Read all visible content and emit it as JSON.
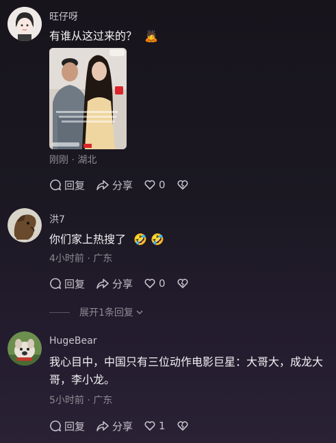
{
  "comments": [
    {
      "username": "旺仔呀",
      "text": "有谁从这过来的？",
      "emoji": "🙇",
      "meta": "刚刚 · 湖北",
      "actions": {
        "reply": "回复",
        "share": "分享",
        "likes": "0"
      }
    },
    {
      "username": "洪7",
      "text": "你们家上热搜了",
      "emoji": "🤣 🤣",
      "meta": "4小时前 · 广东",
      "actions": {
        "reply": "回复",
        "share": "分享",
        "likes": "0"
      },
      "expand": "展开1条回复"
    },
    {
      "username": "HugeBear",
      "text": "我心目中，中国只有三位动作电影巨星：大哥大，成龙大哥，李小龙。",
      "meta": "5小时前 · 广东",
      "actions": {
        "reply": "回复",
        "share": "分享",
        "likes": "1"
      }
    }
  ],
  "colors": {
    "background": "#1b1822",
    "text_primary": "#f2f2f4",
    "text_secondary": "#8e8b94"
  },
  "icons": [
    "comment-bubble-icon",
    "share-arrow-icon",
    "heart-icon",
    "dislike-heart-icon",
    "chevron-down-icon"
  ]
}
